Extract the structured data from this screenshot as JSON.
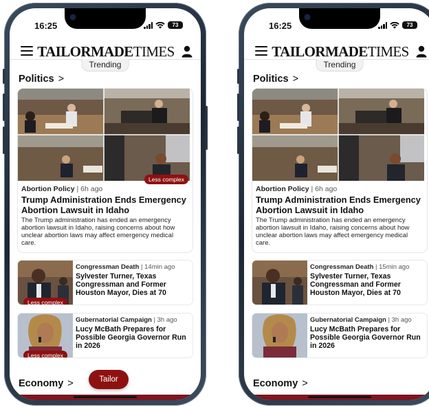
{
  "screens": [
    {
      "status": {
        "time": "16:25",
        "battery": "73"
      },
      "header": {
        "logo_bold": "TAILORMADE",
        "logo_regular": "TIMES",
        "trending": "Trending"
      },
      "sections": {
        "politics": "Politics",
        "economy": "Economy",
        "chevron": ">"
      },
      "featured": {
        "badge": "Less complex",
        "category": "Abortion Policy",
        "time": "| 6h ago",
        "title": "Trump Administration Ends Emergency Abortion Lawsuit in Idaho",
        "summary": "The Trump administration has ended an emergency abortion lawsuit in Idaho, raising concerns about how unclear abortion laws may affect emergency medical care."
      },
      "articles": [
        {
          "category": "Congressman Death",
          "time": "| 14min ago",
          "title": "Sylvester Turner, Texas Congressman and Former Houston Mayor, Dies at 70",
          "badge": "Less complex"
        },
        {
          "category": "Gubernatorial Campaign",
          "time": "| 3h ago",
          "title": "Lucy McBath Prepares for Possible Georgia Governor Run in 2026",
          "badge": "Less complex"
        }
      ],
      "tailor_button": "Tailor"
    },
    {
      "status": {
        "time": "16:25",
        "battery": "73"
      },
      "header": {
        "logo_bold": "TAILORMADE",
        "logo_regular": "TIMES",
        "trending": "Trending"
      },
      "sections": {
        "politics": "Politics",
        "economy": "Economy",
        "chevron": ">"
      },
      "featured": {
        "category": "Abortion Policy",
        "time": "| 6h ago",
        "title": "Trump Administration Ends Emergency Abortion Lawsuit in Idaho",
        "summary": "The Trump administration has ended an emergency abortion lawsuit in Idaho, raising concerns about how unclear abortion laws may affect emergency medical care."
      },
      "articles": [
        {
          "category": "Congressman Death",
          "time": "| 15min ago",
          "title": "Sylvester Turner, Texas Congressman and Former Houston Mayor, Dies at 70"
        },
        {
          "category": "Gubernatorial Campaign",
          "time": "| 3h ago",
          "title": "Lucy McBath Prepares for Possible Georgia Governor Run in 2026"
        }
      ]
    }
  ],
  "colors": {
    "accent": "#8e1111",
    "phone_frame": "#1d2733",
    "bottom_bar": "#7e1520"
  },
  "icons": {
    "menu": "hamburger-menu-icon",
    "profile": "person-icon",
    "signal": "cellular-signal-icon",
    "wifi": "wifi-icon",
    "battery": "battery-icon"
  }
}
